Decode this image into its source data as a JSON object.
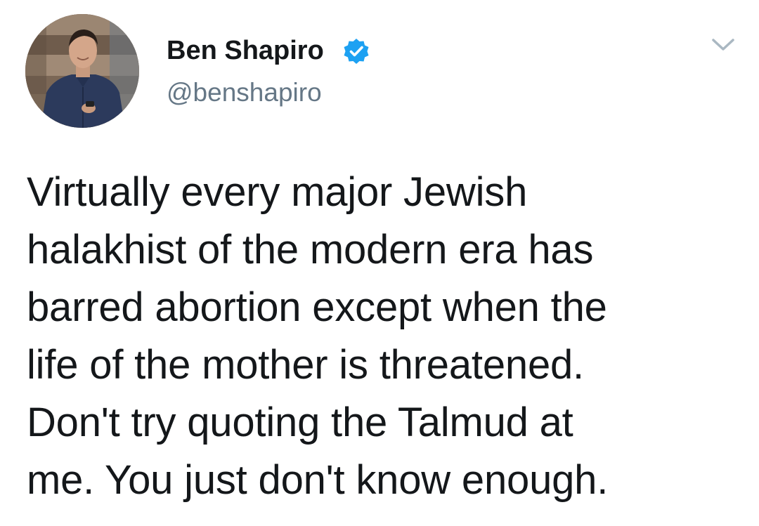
{
  "author": {
    "display_name": "Ben Shapiro",
    "handle": "@benshapiro",
    "verified": true,
    "verified_icon": "verified-badge-icon"
  },
  "menu": {
    "icon": "chevron-down-icon"
  },
  "tweet": {
    "text": "Virtually every major Jewish\nhalakhist of the modern era has\nbarred abortion except when the\nlife of the mother is threatened.\nDon't try quoting the Talmud at\nme. You just don't know enough."
  },
  "colors": {
    "name": "#14171a",
    "handle": "#657786",
    "verified": "#1da1f2",
    "chevron": "#aab8c2"
  }
}
